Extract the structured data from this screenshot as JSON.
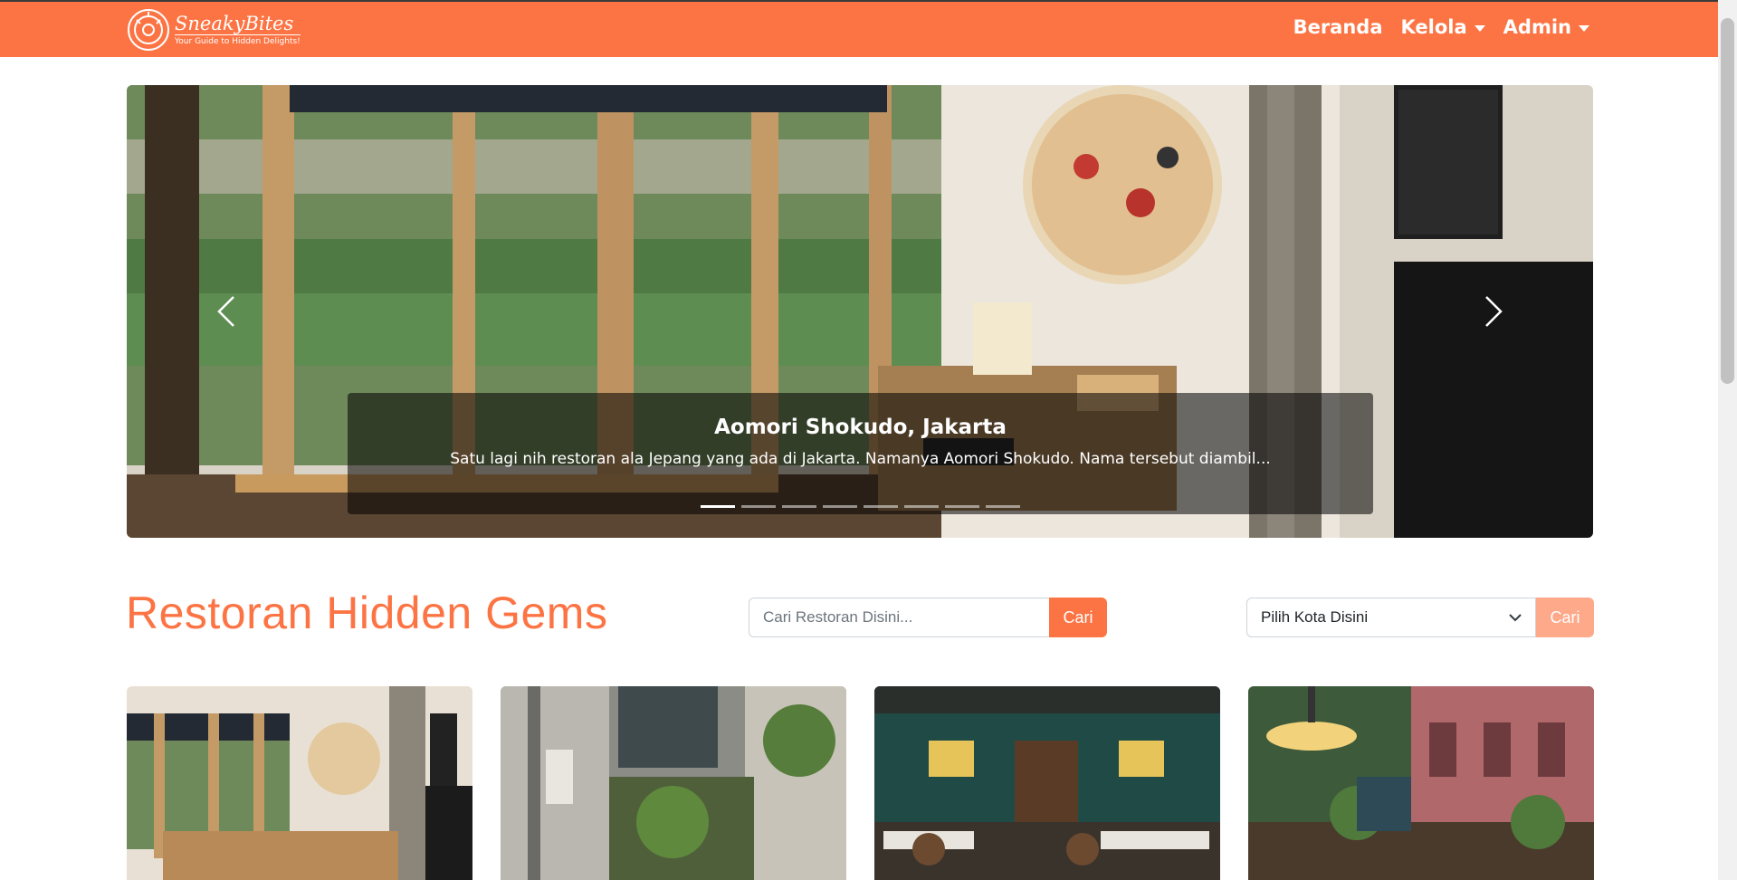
{
  "brand": {
    "name": "SneakyBites",
    "tagline": "Your Guide to Hidden Delights!",
    "logo_icon": "donut-logo-icon"
  },
  "nav": {
    "home": "Beranda",
    "manage": "Kelola",
    "admin": "Admin"
  },
  "carousel": {
    "title": "Aomori Shokudo, Jakarta",
    "text": "Satu lagi nih restoran ala Jepang yang ada di Jakarta. Namanya Aomori Shokudo. Nama tersebut diambil...",
    "slide_count": 8,
    "active_index": 0,
    "prev_icon": "chevron-left-icon",
    "next_icon": "chevron-right-icon"
  },
  "section": {
    "title": "Restoran Hidden Gems"
  },
  "search": {
    "placeholder": "Cari Restoran Disini...",
    "button": "Cari"
  },
  "city_filter": {
    "selected": "Pilih Kota Disini",
    "button": "Cari"
  },
  "colors": {
    "brand": "#fc7444",
    "brand_disabled": "#fda98a"
  }
}
